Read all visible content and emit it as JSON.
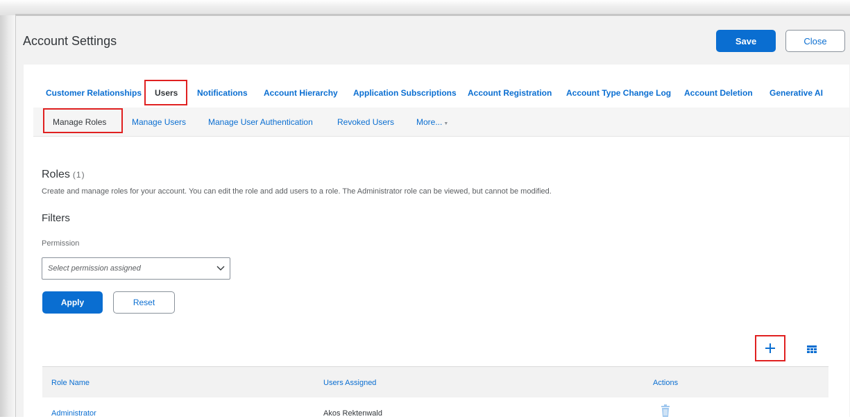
{
  "header": {
    "title": "Account Settings",
    "save_label": "Save",
    "close_label": "Close"
  },
  "tabs": [
    {
      "label": "Customer Relationships"
    },
    {
      "label": "Users"
    },
    {
      "label": "Notifications"
    },
    {
      "label": "Account Hierarchy"
    },
    {
      "label": "Application Subscriptions"
    },
    {
      "label": "Account Registration"
    },
    {
      "label": "Account Type Change Log"
    },
    {
      "label": "Account Deletion"
    },
    {
      "label": "Generative AI"
    }
  ],
  "subtabs": [
    {
      "label": "Manage Roles"
    },
    {
      "label": "Manage Users"
    },
    {
      "label": "Manage User Authentication"
    },
    {
      "label": "Revoked Users"
    },
    {
      "label": "More..."
    }
  ],
  "roles": {
    "title": "Roles",
    "count": "(1)",
    "description": "Create and manage roles for your account. You can edit the role and add users to a role. The Administrator role can be viewed, but cannot be modified."
  },
  "filters": {
    "title": "Filters",
    "permission_label": "Permission",
    "permission_placeholder": "Select permission assigned",
    "apply_label": "Apply",
    "reset_label": "Reset"
  },
  "table": {
    "columns": [
      "Role Name",
      "Users Assigned",
      "Actions"
    ],
    "rows": [
      {
        "role_name": "Administrator",
        "users_assigned": "Akos Rektenwald"
      }
    ]
  },
  "icons": {
    "add": "plus-icon",
    "table_settings": "table-settings-icon",
    "dropdown": "chevron-down-icon",
    "delete": "trash-icon"
  },
  "colors": {
    "accent": "#0a6ed1",
    "highlight": "#e02020"
  }
}
